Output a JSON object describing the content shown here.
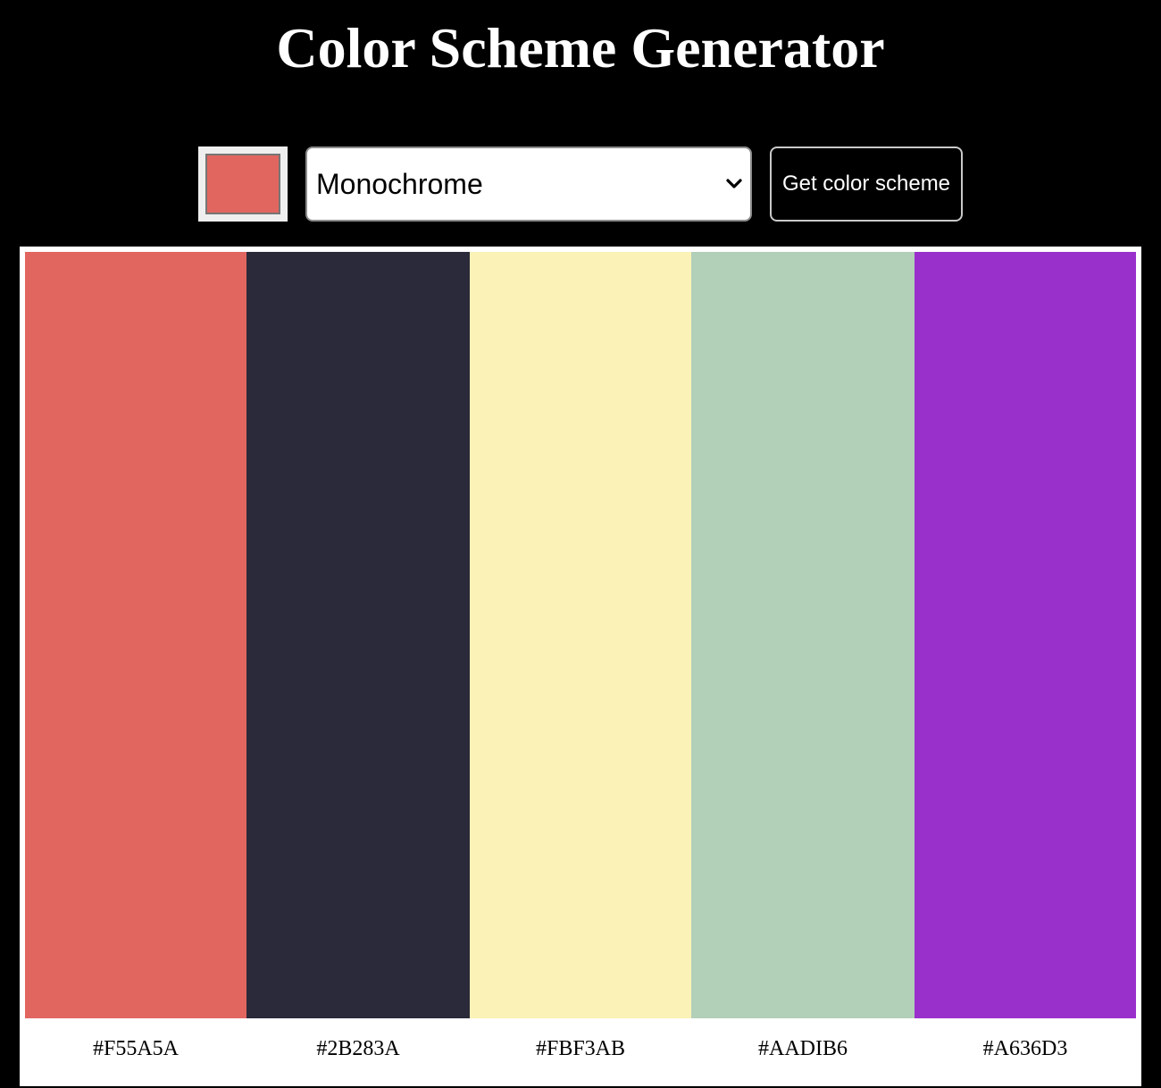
{
  "header": {
    "title": "Color Scheme Generator"
  },
  "controls": {
    "picker_color": "#e26660",
    "mode_value": "Monochrome",
    "button_label": "Get color scheme"
  },
  "palette": [
    {
      "hex": "#F55A5A",
      "display_color": "#e26660"
    },
    {
      "hex": "#2B283A",
      "display_color": "#2b2a3a"
    },
    {
      "hex": "#FBF3AB",
      "display_color": "#faf2b6"
    },
    {
      "hex": "#AADIB6",
      "display_color": "#b2cfb8"
    },
    {
      "hex": "#A636D3",
      "display_color": "#9a30cc"
    }
  ]
}
